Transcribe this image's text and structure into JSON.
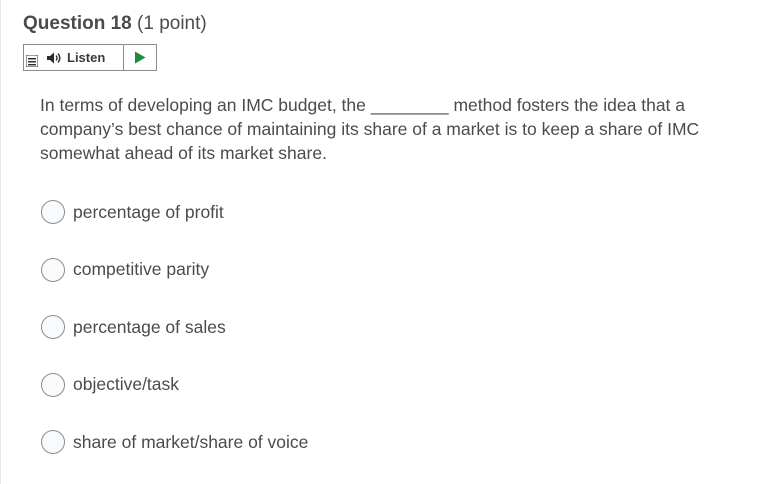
{
  "question": {
    "title": "Question 18",
    "points": " (1 point)",
    "text": "In terms of developing an IMC budget, the ________ method fosters the idea that a company’s best chance of maintaining its share of a market is to keep a share of IMC somewhat ahead of its market share."
  },
  "toolbar": {
    "listen_label": "Listen",
    "menu_icon": "menu-icon",
    "speaker_icon": "speaker-icon",
    "play_icon": "play-icon",
    "play_color": "#1e8a3e"
  },
  "options": [
    {
      "label": "percentage of profit",
      "selected": false
    },
    {
      "label": "competitive parity",
      "selected": false
    },
    {
      "label": "percentage of sales",
      "selected": false
    },
    {
      "label": "objective/task",
      "selected": false
    },
    {
      "label": "share of market/share of voice",
      "selected": false
    }
  ]
}
